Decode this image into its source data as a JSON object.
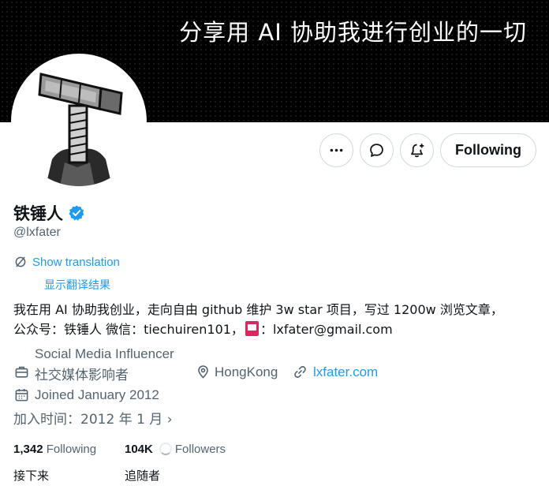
{
  "banner": {
    "text": "分享用 AI 协助我进行创业的一切"
  },
  "actions": {
    "more_icon": "more-horizontal-icon",
    "message_icon": "message-bubble-icon",
    "notify_icon": "bell-plus-icon",
    "follow_label": "Following"
  },
  "profile": {
    "display_name": "铁锤人",
    "handle": "@lxfater",
    "verified": true
  },
  "translation": {
    "show_label": "Show translation",
    "show_label_cn": "显示翻译结果"
  },
  "bio": {
    "line1": "我在用 AI 协助我创业，走向自由 github 维护 3w star 项目，写过 1200w 浏览文章，",
    "line2_a": "公众号：铁锤人 微信：tiechuiren101，",
    "line2_b": "：lxfater@gmail.com"
  },
  "meta": {
    "category": "Social Media Influencer",
    "category_cn": "社交媒体影响者",
    "location": "HongKong",
    "website": "lxfater.com",
    "joined": "Joined January 2012",
    "joined_cn": "加入时间：2012 年 1 月"
  },
  "stats": {
    "following_count": "1,342",
    "following_label": "Following",
    "following_cn": "接下来",
    "followers_count": "104K",
    "followers_label": "Followers",
    "followers_cn": "追随者"
  },
  "colors": {
    "accent": "#1d9bf0",
    "secondary_text": "#536471",
    "primary_text": "#0f1419"
  }
}
